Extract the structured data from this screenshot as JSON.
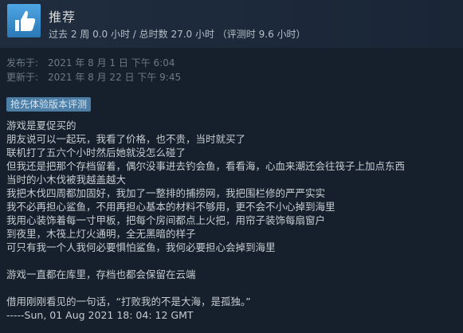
{
  "header": {
    "thumb_icon": "thumbs-up-icon",
    "title": "推荐",
    "hours_text": "过去 2 周 0.0 小时 / 总时数 27.0 小时 （评测时 9.6 小时）"
  },
  "dates": {
    "posted_label": "发布于:",
    "posted_value": "2021 年 8 月 1 日 下午 6:04",
    "updated_label": "更新于:",
    "updated_value": "2021 年 8 月 22 日 下午 9:45"
  },
  "badge": {
    "early_access": "抢先体验版本评测"
  },
  "review": {
    "lines": [
      "游戏是夏促买的",
      "朋友说可以一起玩，我看了价格，也不贵，当时就买了",
      "联机打了五六个小时然后她就没怎么碰了",
      "但我还是把那个存档留着，偶尔没事进去钓会鱼，看看海，心血来潮还会往筏子上加点东西",
      "当时的小木伐被我越盖越大",
      "我把木伐四周都加固好，我加了一整排的捕捞网，我把围栏修的严严实实",
      "我不必再担心鲨鱼，不用再担心基本的材料不够用，更不会不小心掉到海里",
      "我用心装饰着每一寸甲板，把每个房间都点上火把，用帘子装饰每扇窗户",
      "到夜里，木筏上灯火通明，全无黑暗的样子",
      "可只有我一个人我何必要惧怕鲨鱼，我何必要担心会掉到海里",
      "游戏一直都在库里，存档也都会保留在云端",
      "借用刚刚看见的一句话，“打败我的不是大海，是孤独。”",
      "-----Sun, 01 Aug 2021 18: 04: 12 GMT"
    ]
  }
}
